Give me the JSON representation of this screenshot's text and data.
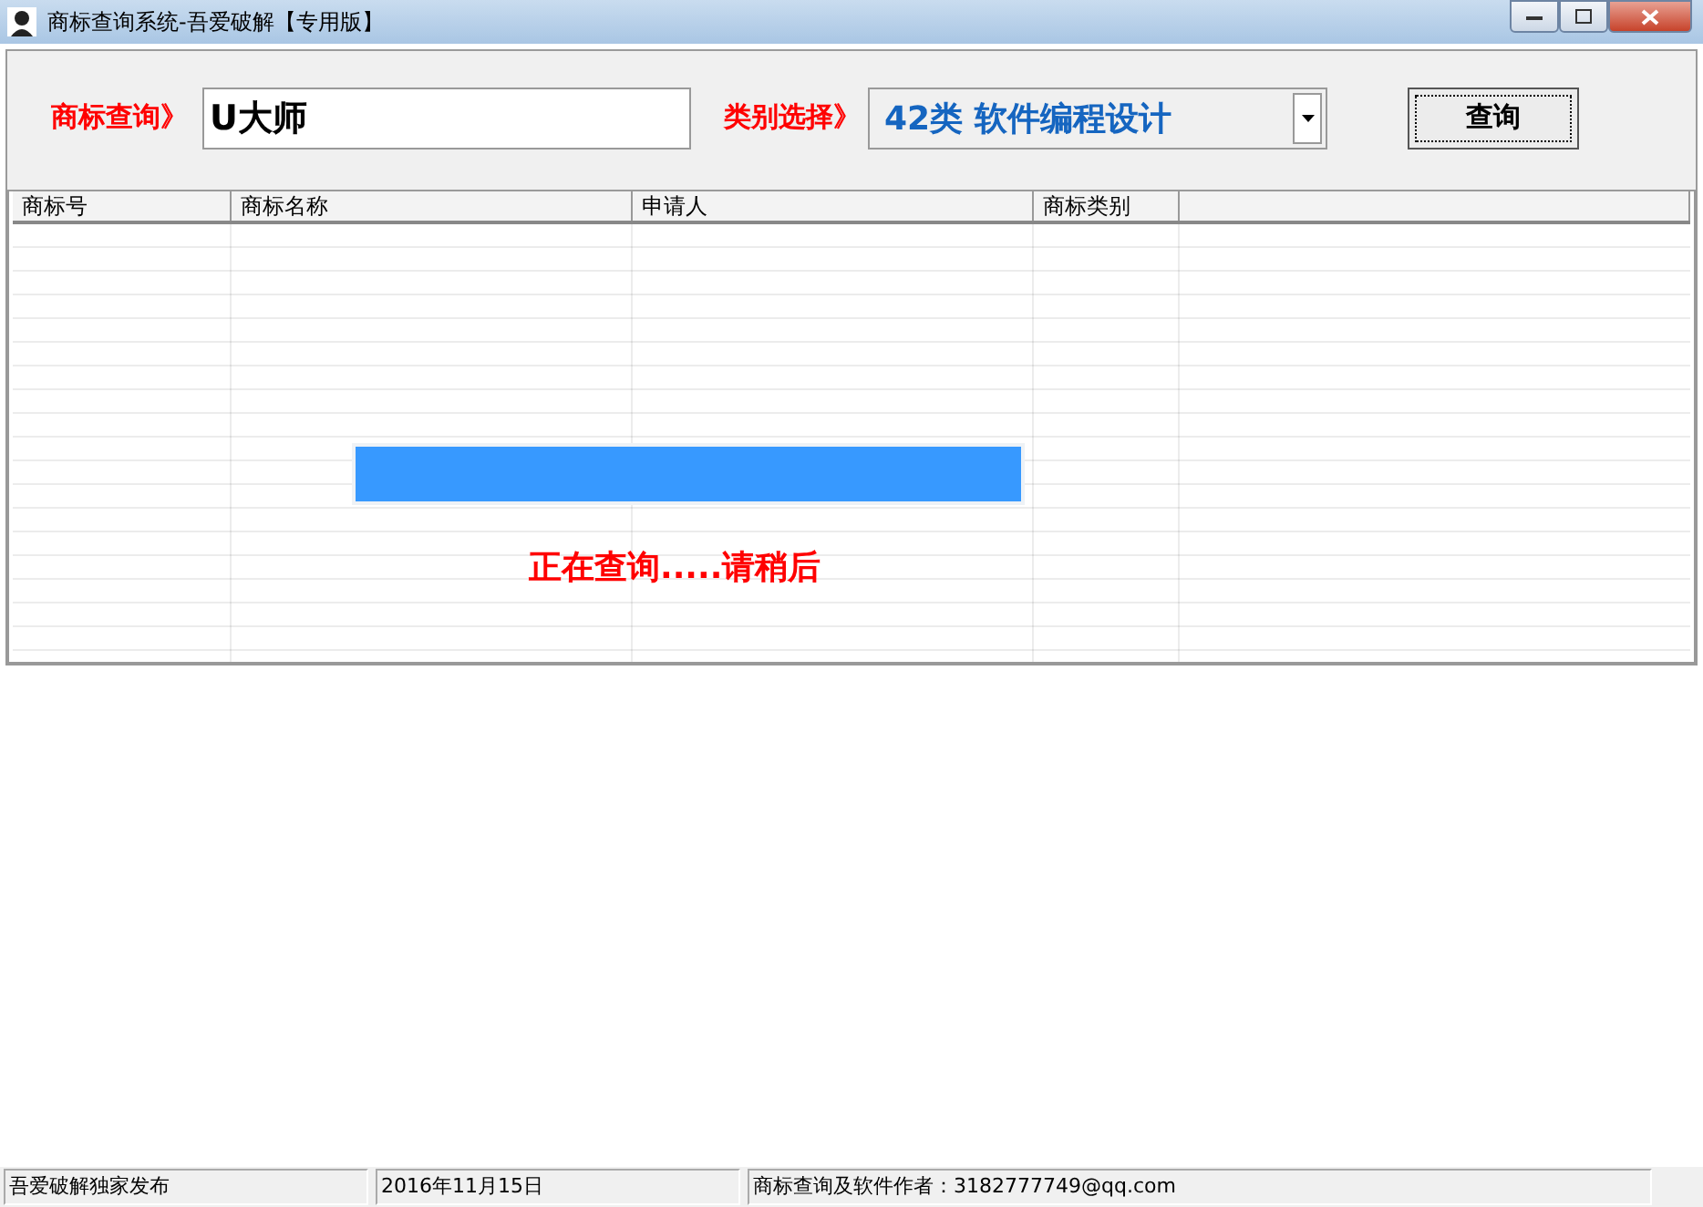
{
  "window": {
    "title": "商标查询系统-吾爱破解【专用版】"
  },
  "search": {
    "label": "商标查询》",
    "value": "U大师"
  },
  "category": {
    "label": "类别选择》",
    "value": "42类 软件编程设计"
  },
  "query_button": "查询",
  "table": {
    "columns": [
      "商标号",
      "商标名称",
      "申请人",
      "商标类别"
    ]
  },
  "progress": {
    "level": 1
  },
  "message": "正在查询.....请稍后",
  "status_bar": [
    "吾爱破解独家发布",
    "2016年11月15日",
    "商标查询及软件作者：3182777749@qq.com"
  ]
}
